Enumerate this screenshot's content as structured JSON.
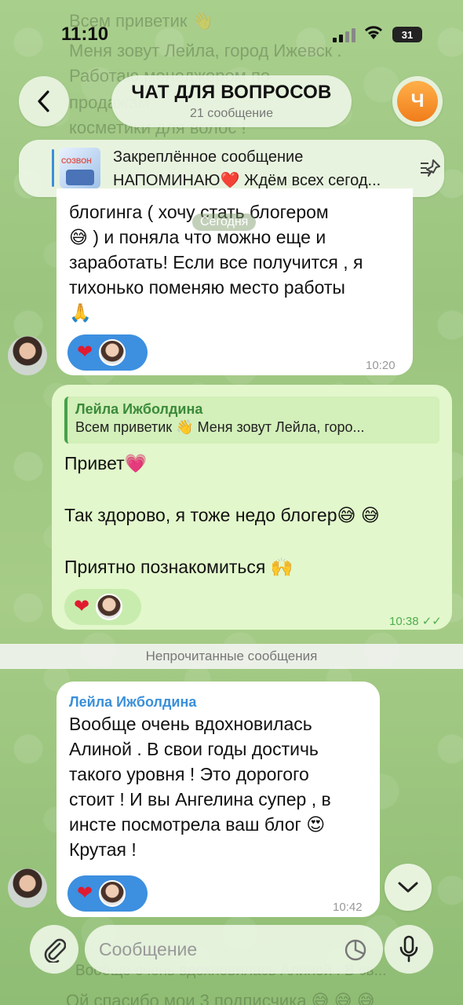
{
  "status_bar": {
    "time": "11:10",
    "battery": "31"
  },
  "header": {
    "title": "ЧАТ ДЛЯ ВОПРОСОВ",
    "subtitle": "21 сообщение",
    "avatar_letter": "Ч",
    "avatar_color": "#f08a24"
  },
  "pinned": {
    "title": "Закреплённое сообщение",
    "text": "НАПОМИНАЮ❤️ Ждём всех сегод...",
    "thumb_label": "СОЗВОН"
  },
  "date_badge": "Сегодня",
  "background_ghost": {
    "line1": "Всем приветик 👋",
    "line2": "Меня зовут Лейла, город Ижевск .",
    "line3": "Работаю менеджером по",
    "line4": "продажам",
    "line5": "косметики для волос !"
  },
  "messages": [
    {
      "lines": [
        "блогинга ( хочу стать блогером",
        "😅 ) и поняла что можно еще и",
        "заработать! Если все получится , я",
        "тихонько поменяю место работы",
        "🙏"
      ],
      "time": "10:20"
    },
    {
      "reply_sender": "Лейла Ижболдина",
      "reply_text": "Всем приветик 👋 Меня зовут Лейла, горо...",
      "lines": [
        "Привет💗",
        "",
        "Так здорово, я тоже недо блогер😅 😅",
        "",
        "Приятно познакомиться 🙌"
      ],
      "time": "10:38"
    },
    {
      "sender": "Лейла Ижболдина",
      "lines": [
        "Вообще очень вдохновилась",
        "Алиной . В свои годы достичь",
        "такого уровня ! Это дорогого",
        "стоит ! И вы Ангелина супер , в",
        "инсте посмотрела ваш блог 😍",
        "Крутая !"
      ],
      "time": "10:42"
    }
  ],
  "unread_divider": "Непрочитанные сообщения",
  "bottom_ghost": {
    "line1": "Вообще очень вдохновилась Алиной . В св...",
    "line2": "Ой спасибо мои 3 подписчика 😅 😅 😅"
  },
  "composer": {
    "placeholder": "Сообщение"
  }
}
